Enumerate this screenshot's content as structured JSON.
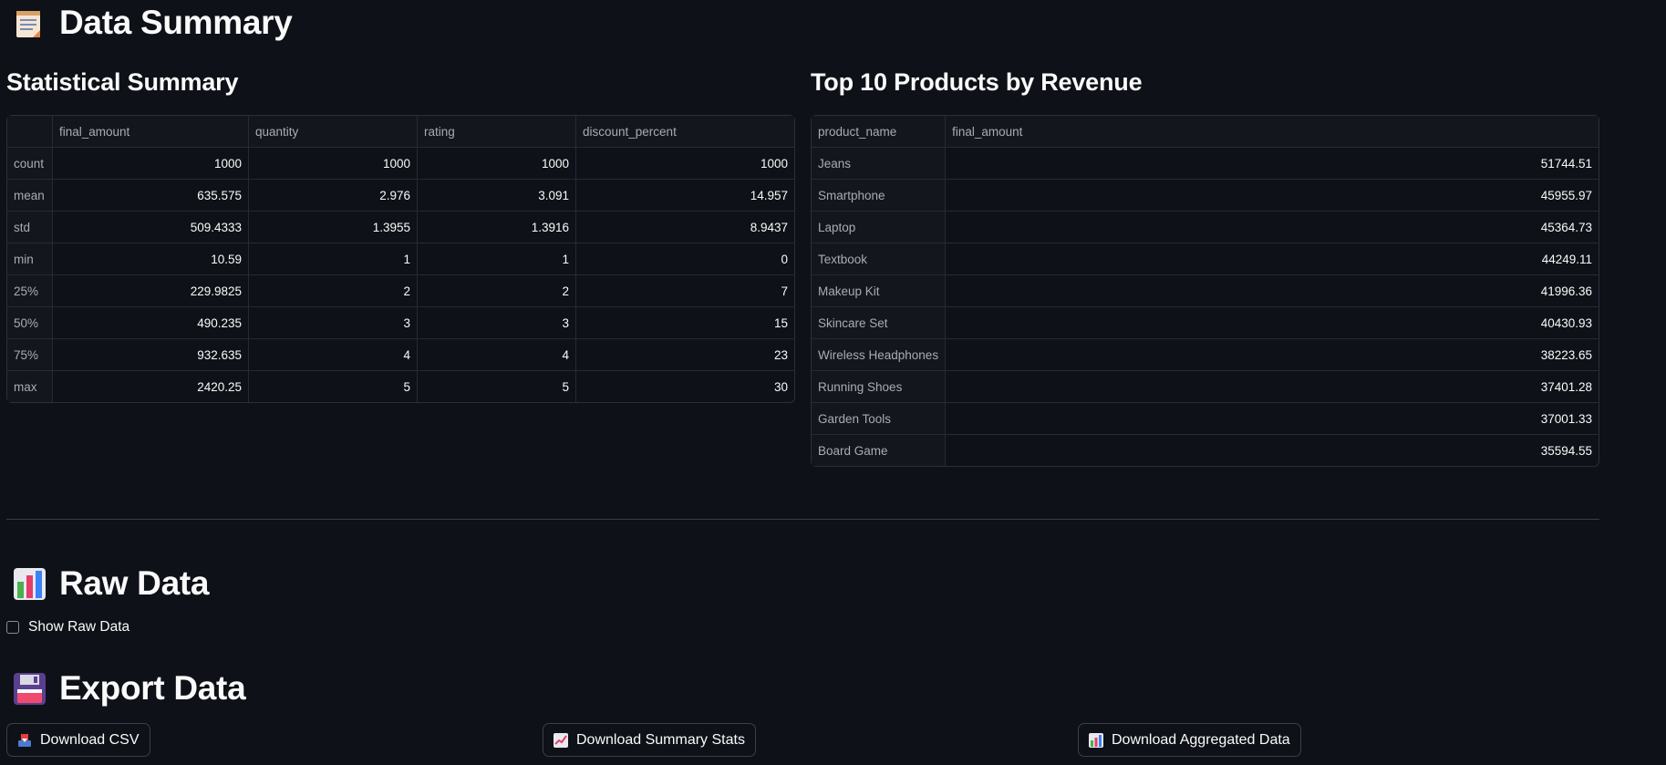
{
  "data_summary": {
    "title": "Data Summary",
    "icon": "memo-icon"
  },
  "stats": {
    "title": "Statistical Summary",
    "columns": [
      "",
      "final_amount",
      "quantity",
      "rating",
      "discount_percent"
    ],
    "rows": [
      [
        "count",
        "1000",
        "1000",
        "1000",
        "1000"
      ],
      [
        "mean",
        "635.575",
        "2.976",
        "3.091",
        "14.957"
      ],
      [
        "std",
        "509.4333",
        "1.3955",
        "1.3916",
        "8.9437"
      ],
      [
        "min",
        "10.59",
        "1",
        "1",
        "0"
      ],
      [
        "25%",
        "229.9825",
        "2",
        "2",
        "7"
      ],
      [
        "50%",
        "490.235",
        "3",
        "3",
        "15"
      ],
      [
        "75%",
        "932.635",
        "4",
        "4",
        "23"
      ],
      [
        "max",
        "2420.25",
        "5",
        "5",
        "30"
      ]
    ]
  },
  "top_products": {
    "title": "Top 10 Products by Revenue",
    "columns": [
      "product_name",
      "final_amount"
    ],
    "rows": [
      [
        "Jeans",
        "51744.51"
      ],
      [
        "Smartphone",
        "45955.97"
      ],
      [
        "Laptop",
        "45364.73"
      ],
      [
        "Textbook",
        "44249.11"
      ],
      [
        "Makeup Kit",
        "41996.36"
      ],
      [
        "Skincare Set",
        "40430.93"
      ],
      [
        "Wireless Headphones",
        "38223.65"
      ],
      [
        "Running Shoes",
        "37401.28"
      ],
      [
        "Garden Tools",
        "37001.33"
      ],
      [
        "Board Game",
        "35594.55"
      ]
    ]
  },
  "raw_data": {
    "title": "Raw Data",
    "icon": "bar-chart-icon",
    "checkbox_label": "Show Raw Data"
  },
  "export": {
    "title": "Export Data",
    "icon": "floppy-disk-icon",
    "buttons": [
      {
        "label": "Download CSV",
        "icon": "inbox-tray-icon"
      },
      {
        "label": "Download Summary Stats",
        "icon": "line-chart-icon"
      },
      {
        "label": "Download Aggregated Data",
        "icon": "bar-chart-icon"
      }
    ]
  },
  "colors": {
    "background": "#0e1117",
    "text": "#fafafa",
    "muted": "#a9acb3",
    "border": "#2b2f3a"
  }
}
